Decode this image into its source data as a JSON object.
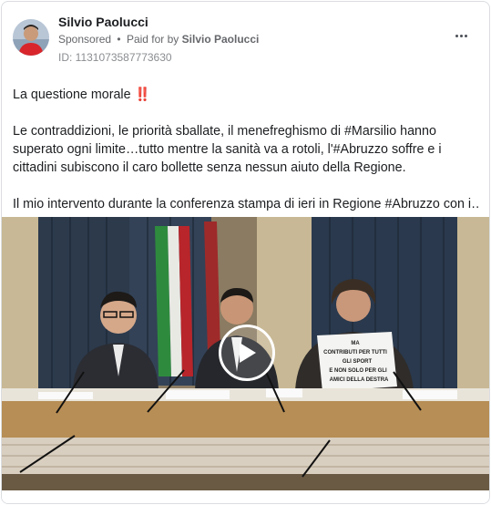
{
  "post": {
    "author": "Silvio Paolucci",
    "sponsored_label": "Sponsored",
    "separator": "•",
    "paid_for_prefix": "Paid for by",
    "payer": "Silvio Paolucci",
    "ad_id": "ID: 1131073587773630",
    "more_icon": "more-horizontal-icon",
    "text_lines": [
      "La questione morale ‼️",
      "Le contraddizioni, le priorità sballate, il menefreghismo di #Marsilio hanno",
      "superato ogni limite…tutto mentre la sanità va a rotoli, l'#Abruzzo soffre e i",
      "cittadini subiscono il caro bollette senza nessun aiuto della Regione.",
      "Il mio intervento durante la conferenza stampa di ieri in Regione #Abruzzo con i…"
    ]
  },
  "video": {
    "play_icon": "play-icon",
    "sign_lines": [
      "MA",
      "CONTRIBUTI PER TUTTI",
      "GLI SPORT",
      "E NON SOLO PER GLI",
      "AMICI DELLA DESTRA"
    ]
  },
  "colors": {
    "text_primary": "#1c1e21",
    "text_secondary": "#65676b",
    "border": "#dadde1"
  }
}
